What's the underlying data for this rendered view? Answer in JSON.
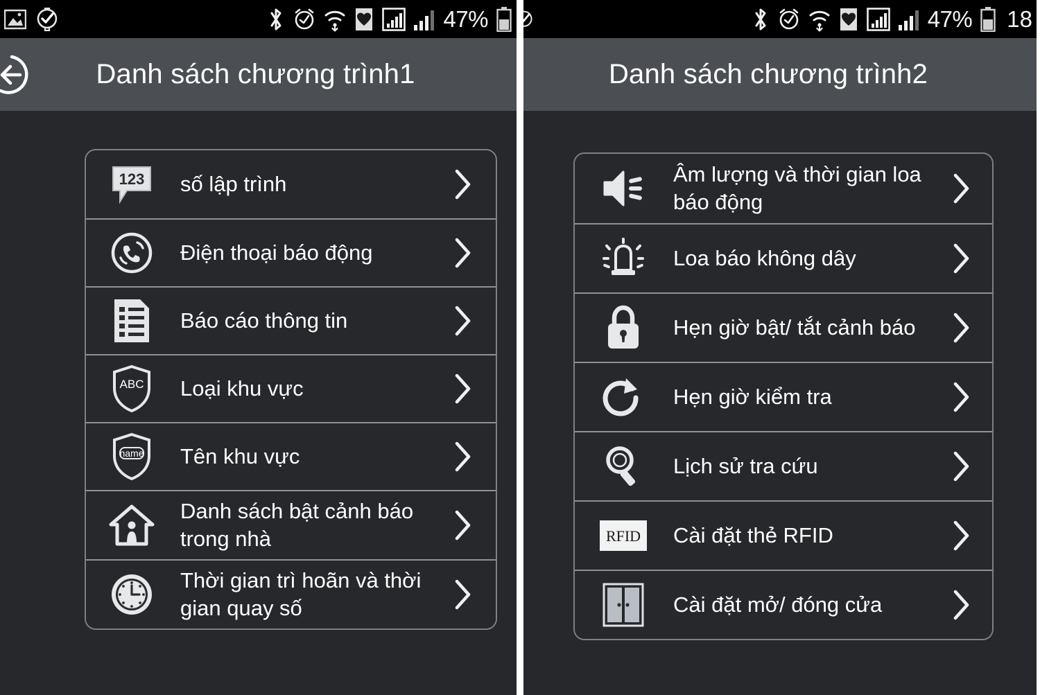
{
  "screens": [
    {
      "name": "program-list-1",
      "statusbar": {
        "left_icons": [
          "screenshot-icon",
          "watch-sync-icon"
        ],
        "right_icons": [
          "bluetooth-icon",
          "alarm-clock-icon",
          "wifi-icon",
          "health-card-icon",
          "signal-boxed-icon",
          "signal-bars-icon"
        ],
        "battery_percent": "47%",
        "battery_icon": "battery-icon",
        "time": ""
      },
      "titlebar": {
        "back_icon": "back-circle-arrow-icon",
        "title": "Danh sách chương trình1"
      },
      "items": [
        {
          "icon": "numeric-123-bubble-icon",
          "label": "số lập trình",
          "chevron": "chevron-right-icon"
        },
        {
          "icon": "phone-alarm-icon",
          "label": "Điện thoại báo động",
          "chevron": "chevron-right-icon"
        },
        {
          "icon": "report-list-icon",
          "label": "Báo cáo thông tin",
          "chevron": "chevron-right-icon"
        },
        {
          "icon": "shield-abc-icon",
          "label": "Loại khu vực",
          "chevron": "chevron-right-icon"
        },
        {
          "icon": "shield-name-icon",
          "label": "Tên khu vực",
          "chevron": "chevron-right-icon"
        },
        {
          "icon": "home-person-icon",
          "label": "Danh sách bật cảnh báo trong nhà",
          "chevron": "chevron-right-icon"
        },
        {
          "icon": "clock-icon",
          "label": "Thời gian trì hoãn và thời gian quay số",
          "chevron": "chevron-right-icon"
        }
      ]
    },
    {
      "name": "program-list-2",
      "statusbar": {
        "left_icons": [
          "watch-sync-icon"
        ],
        "right_icons": [
          "bluetooth-icon",
          "alarm-clock-icon",
          "wifi-icon",
          "health-card-icon",
          "signal-boxed-icon",
          "signal-bars-icon"
        ],
        "battery_percent": "47%",
        "battery_icon": "battery-icon",
        "time": "18"
      },
      "titlebar": {
        "back_icon": "",
        "title": "Danh sách chương trình2"
      },
      "items": [
        {
          "icon": "speaker-volume-icon",
          "label": "Âm lượng và thời gian loa báo động",
          "chevron": "chevron-right-icon"
        },
        {
          "icon": "wireless-siren-icon",
          "label": "Loa báo không dây",
          "chevron": "chevron-right-icon"
        },
        {
          "icon": "padlock-icon",
          "label": "Hẹn giờ bật/ tắt cảnh báo",
          "chevron": "chevron-right-icon"
        },
        {
          "icon": "refresh-timer-icon",
          "label": "Hẹn giờ kiểm tra",
          "chevron": "chevron-right-icon"
        },
        {
          "icon": "magnifier-icon",
          "label": "Lịch sử tra cứu",
          "chevron": "chevron-right-icon"
        },
        {
          "icon": "rfid-card-icon",
          "label": "Cài đặt thẻ RFID",
          "chevron": "chevron-right-icon"
        },
        {
          "icon": "double-door-icon",
          "label": "Cài đặt mở/ đóng cửa",
          "chevron": "chevron-right-icon"
        }
      ]
    }
  ],
  "colors": {
    "statusbar_bg": "#000000",
    "titlebar_bg": "#4b4f53",
    "screen_bg": "#26282c",
    "card_border": "#7d8085",
    "row_divider": "#8e9196",
    "text": "#ffffff",
    "icon": "#e6e8ea"
  }
}
